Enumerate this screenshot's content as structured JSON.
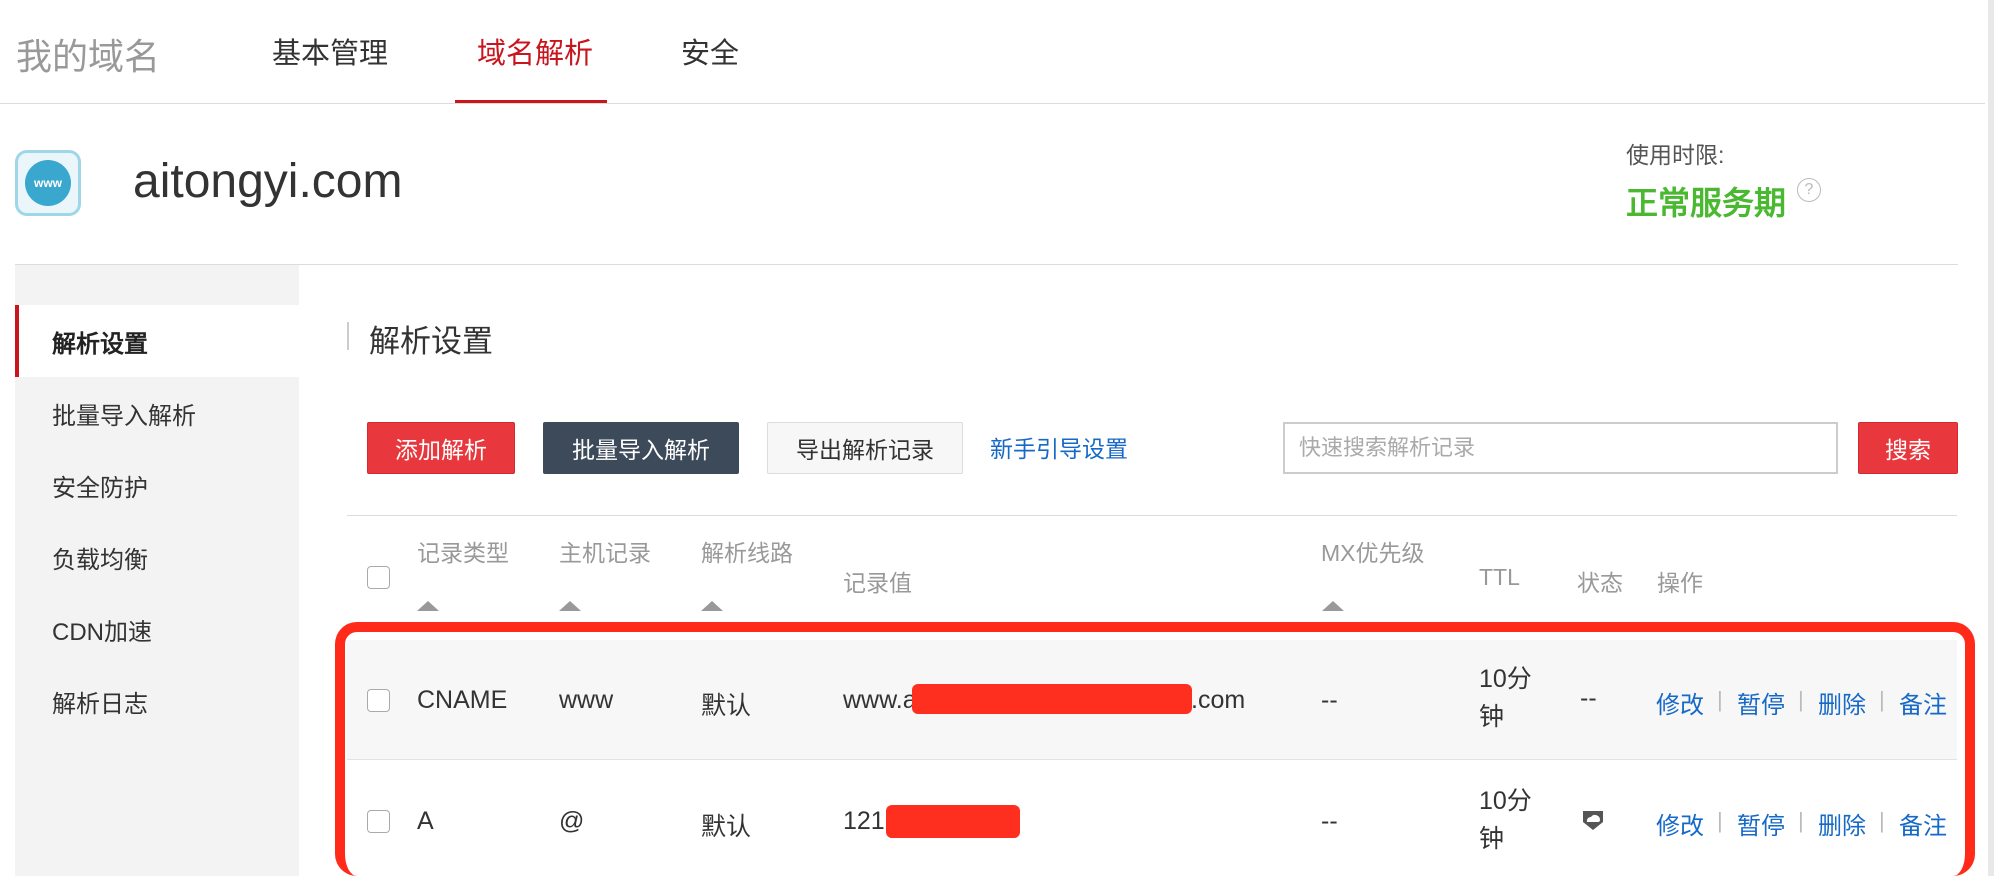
{
  "topnav": {
    "brand": "我的域名",
    "tabs": [
      {
        "label": "基本管理"
      },
      {
        "label": "域名解析"
      },
      {
        "label": "安全"
      }
    ]
  },
  "domain": {
    "icon_text": "www",
    "name": "aitongyi.com",
    "term_label": "使用时限:",
    "term_value": "正常服务期",
    "help_icon": "?"
  },
  "sidebar": {
    "items": [
      {
        "label": "解析设置"
      },
      {
        "label": "批量导入解析"
      },
      {
        "label": "安全防护"
      },
      {
        "label": "负载均衡"
      },
      {
        "label": "CDN加速"
      },
      {
        "label": "解析日志"
      }
    ]
  },
  "content": {
    "title": "解析设置",
    "toolbar": {
      "add_label": "添加解析",
      "batch_label": "批量导入解析",
      "export_label": "导出解析记录",
      "guide_label": "新手引导设置",
      "search_placeholder": "快速搜索解析记录",
      "search_button": "搜索"
    }
  },
  "table": {
    "headers": [
      "记录类型",
      "主机记录",
      "解析线路",
      "记录值",
      "MX优先级",
      "TTL",
      "状态",
      "操作"
    ],
    "rows": [
      {
        "type": "CNAME",
        "host": "www",
        "line": "默认",
        "value_prefix": "www.a",
        "value_suffix": ".com",
        "mx": "--",
        "ttl": "10分钟",
        "status": "--"
      },
      {
        "type": "A",
        "host": "@",
        "line": "默认",
        "value_prefix": "121",
        "value_suffix": "",
        "mx": "--",
        "ttl": "10分钟",
        "status": ""
      }
    ],
    "actions": [
      "修改",
      "暂停",
      "删除",
      "备注"
    ],
    "action_separator": "|"
  },
  "colors": {
    "accent_red": "#c9161e",
    "button_red": "#e8383d",
    "button_dark": "#3c4a5a",
    "link_blue": "#1769c7",
    "status_green": "#4bb832",
    "highlight": "#ff2a1a"
  }
}
